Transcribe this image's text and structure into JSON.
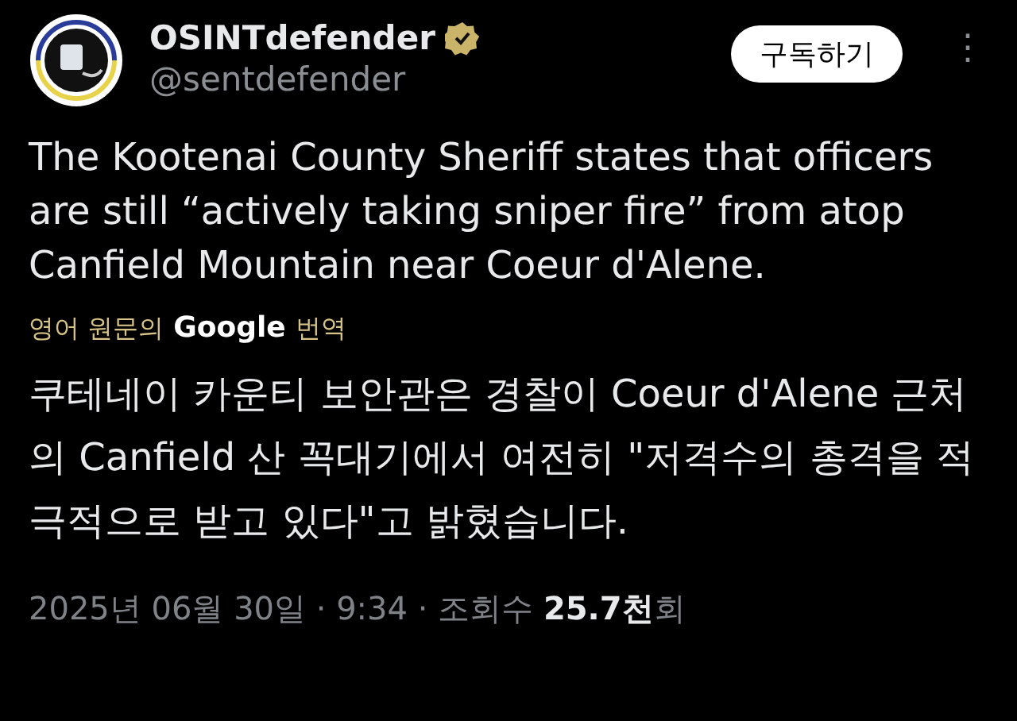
{
  "author": {
    "name": "OSINTdefender",
    "verified": true,
    "handle": "@sentdefender"
  },
  "subscribe_button": "구독하기",
  "more_menu": "⋮",
  "post_text": "The Kootenai County Sheriff states that officers are still “actively taking sniper fire” from atop Canfield Mountain near Coeur d'Alene.",
  "translation": {
    "prefix": "영어 원문의",
    "provider": "Google",
    "suffix": "번역"
  },
  "translated_text": "쿠테네이 카운티 보안관은 경찰이 Coeur d'Alene 근처의 Canfield 산 꼭대기에서 여전히 \"저격수의 총격을 적극적으로 받고 있다\"고 밝혔습니다.",
  "meta": "2025년 06월 30일 · 9:34 · 조회수 **25.7천**회"
}
